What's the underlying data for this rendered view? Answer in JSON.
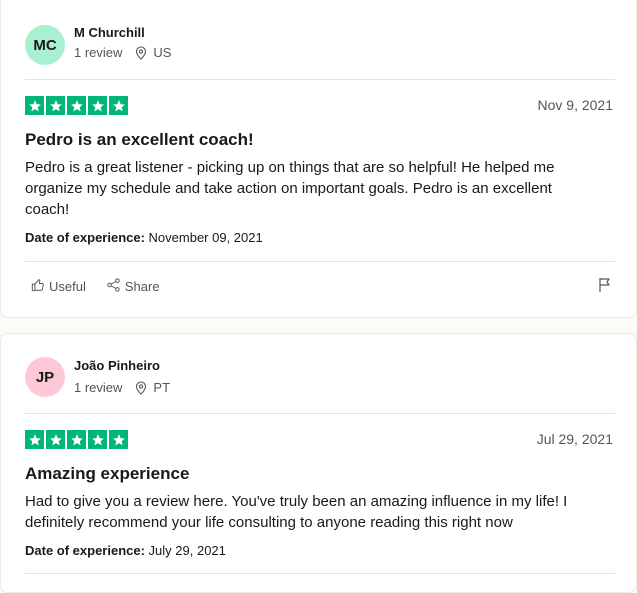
{
  "reviews": [
    {
      "avatar_initials": "MC",
      "avatar_color": "#a8f0cf",
      "reviewer_name": "M Churchill",
      "review_count": "1 review",
      "country": "US",
      "rating": 5,
      "date": "Nov 9, 2021",
      "title": "Pedro is an excellent coach!",
      "text": "Pedro is a great listener - picking up on things that are so helpful! He helped me organize my schedule and take action on important goals. Pedro is an excellent coach!",
      "experience_label": "Date of experience:",
      "experience_date": "November 09, 2021",
      "useful_label": "Useful",
      "share_label": "Share"
    },
    {
      "avatar_initials": "JP",
      "avatar_color": "#fdc9d6",
      "reviewer_name": "João Pinheiro",
      "review_count": "1 review",
      "country": "PT",
      "rating": 5,
      "date": "Jul 29, 2021",
      "title": "Amazing experience",
      "text": "Had to give you a review here. You've truly been an amazing influence in my life! I definitely recommend your life consulting to anyone reading this right now",
      "experience_label": "Date of experience:",
      "experience_date": "July 29, 2021"
    }
  ],
  "colors": {
    "star_green": "#00b67a",
    "text_primary": "#191919",
    "text_secondary": "#555555"
  },
  "icons": {
    "star": "star-icon",
    "location": "location-pin-icon",
    "useful": "thumbs-up-icon",
    "share": "share-icon",
    "flag": "flag-icon"
  }
}
